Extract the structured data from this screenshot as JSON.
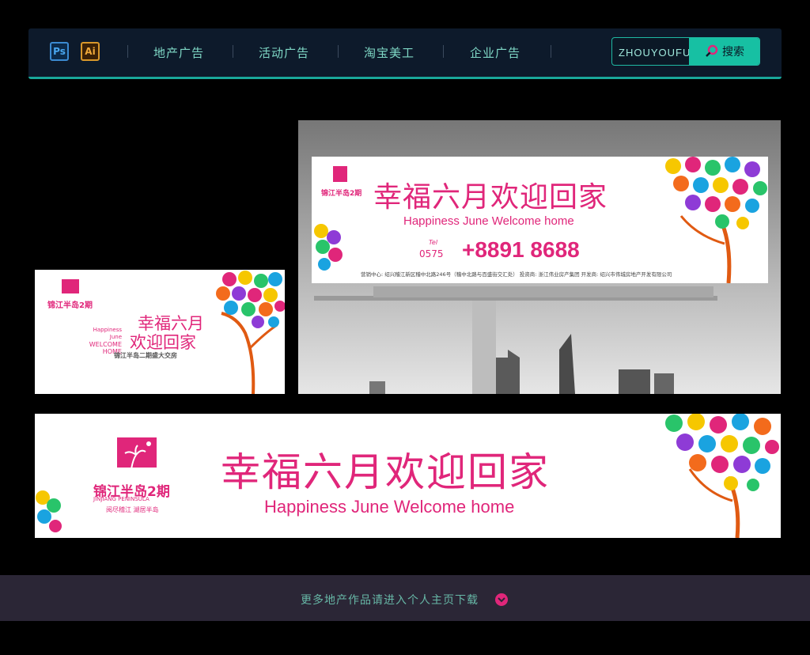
{
  "nav": {
    "ps_label": "Ps",
    "ai_label": "Ai",
    "items": [
      "地产广告",
      "活动广告",
      "淘宝美工",
      "企业广告"
    ],
    "search_value": "ZHOUYOUFU",
    "search_button": "搜索"
  },
  "ad": {
    "brand_cn": "锦江半岛2期",
    "brand_en": "JINJIANG PENINSULA",
    "brand_tagline": "阅尽稽江 湖居半岛",
    "headline": "幸福六月欢迎回家",
    "headline_line1": "幸福六月",
    "headline_line2": "欢迎回家",
    "english": "Happiness June  Welcome home",
    "welcome_small_1": "Happiness June",
    "welcome_small_2": "WELCOME",
    "welcome_small_3": "HOME",
    "small_sub": "锦江半岛二期盛大交房",
    "tel_label": "Tel",
    "area_code": "0575",
    "phone": "+8891 8688",
    "sales_label": "营销中心:",
    "sales_addr": "绍兴稽江新区稽中北路246号（稽中北路与百盛街交汇处）",
    "investor_label": "投资商:",
    "investor": "浙江伟业房产集团",
    "developer_label": "开发商:",
    "developer": "绍兴市伟城房地产开发有限公司"
  },
  "footer": {
    "text": "更多地产作品请进入个人主页下载"
  },
  "colors": {
    "accent": "#e0267a",
    "teal": "#17c0a3",
    "nav_bg": "#0d1a2b",
    "footer_bg": "#2b2636"
  }
}
